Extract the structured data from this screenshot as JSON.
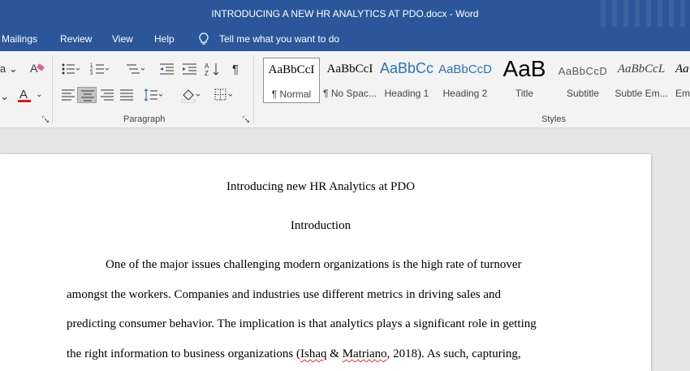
{
  "window": {
    "doc_name": "INTRODUCING A NEW HR ANALYTICS AT PDO.docx",
    "separator": " - ",
    "app_name": "Word"
  },
  "menu": {
    "items": [
      "Mailings",
      "Review",
      "View",
      "Help"
    ],
    "tell_me": "Tell me what you want to do"
  },
  "ribbon": {
    "font_group": {
      "highlight_glyph": "a",
      "font_color_glyph": "A",
      "font_color": "#e81123"
    },
    "paragraph_group": {
      "label": "Paragraph",
      "pilcrow": "¶"
    },
    "styles_group": {
      "label": "Styles",
      "styles": [
        {
          "preview": "AaBbCcI",
          "name": "¶ Normal",
          "selected": true
        },
        {
          "preview": "AaBbCcI",
          "name": "¶ No Spac...",
          "selected": false
        },
        {
          "preview": "AaBbCc",
          "name": "Heading 1",
          "selected": false
        },
        {
          "preview": "AaBbCcD",
          "name": "Heading 2",
          "selected": false
        },
        {
          "preview": "AaB",
          "name": "Title",
          "selected": false
        },
        {
          "preview": "AaBbCcD",
          "name": "Subtitle",
          "selected": false
        },
        {
          "preview": "AaBbCcL",
          "name": "Subtle Em...",
          "selected": false
        },
        {
          "preview": "Aa",
          "name": "Em",
          "selected": false
        }
      ]
    }
  },
  "document": {
    "title": "Introducing new HR Analytics at PDO",
    "heading": "Introduction",
    "lines": [
      "One of the major issues challenging modern organizations is the high rate of turnover",
      "amongst the workers. Companies and industries use different metrics in driving sales and",
      "predicting consumer behavior. The implication is that analytics plays a significant role in getting"
    ],
    "last_line": {
      "before": "the right information to business organizations (",
      "cite_a": "Ishaq",
      "amp": " & ",
      "cite_b": "Matriano",
      "after": ", 2018). As such, capturing,"
    }
  },
  "colors": {
    "title_bar": "#2b579a",
    "ribbon": "#f3f3f3",
    "canvas": "#e6e6e6",
    "spellcheck": "#d13438"
  }
}
